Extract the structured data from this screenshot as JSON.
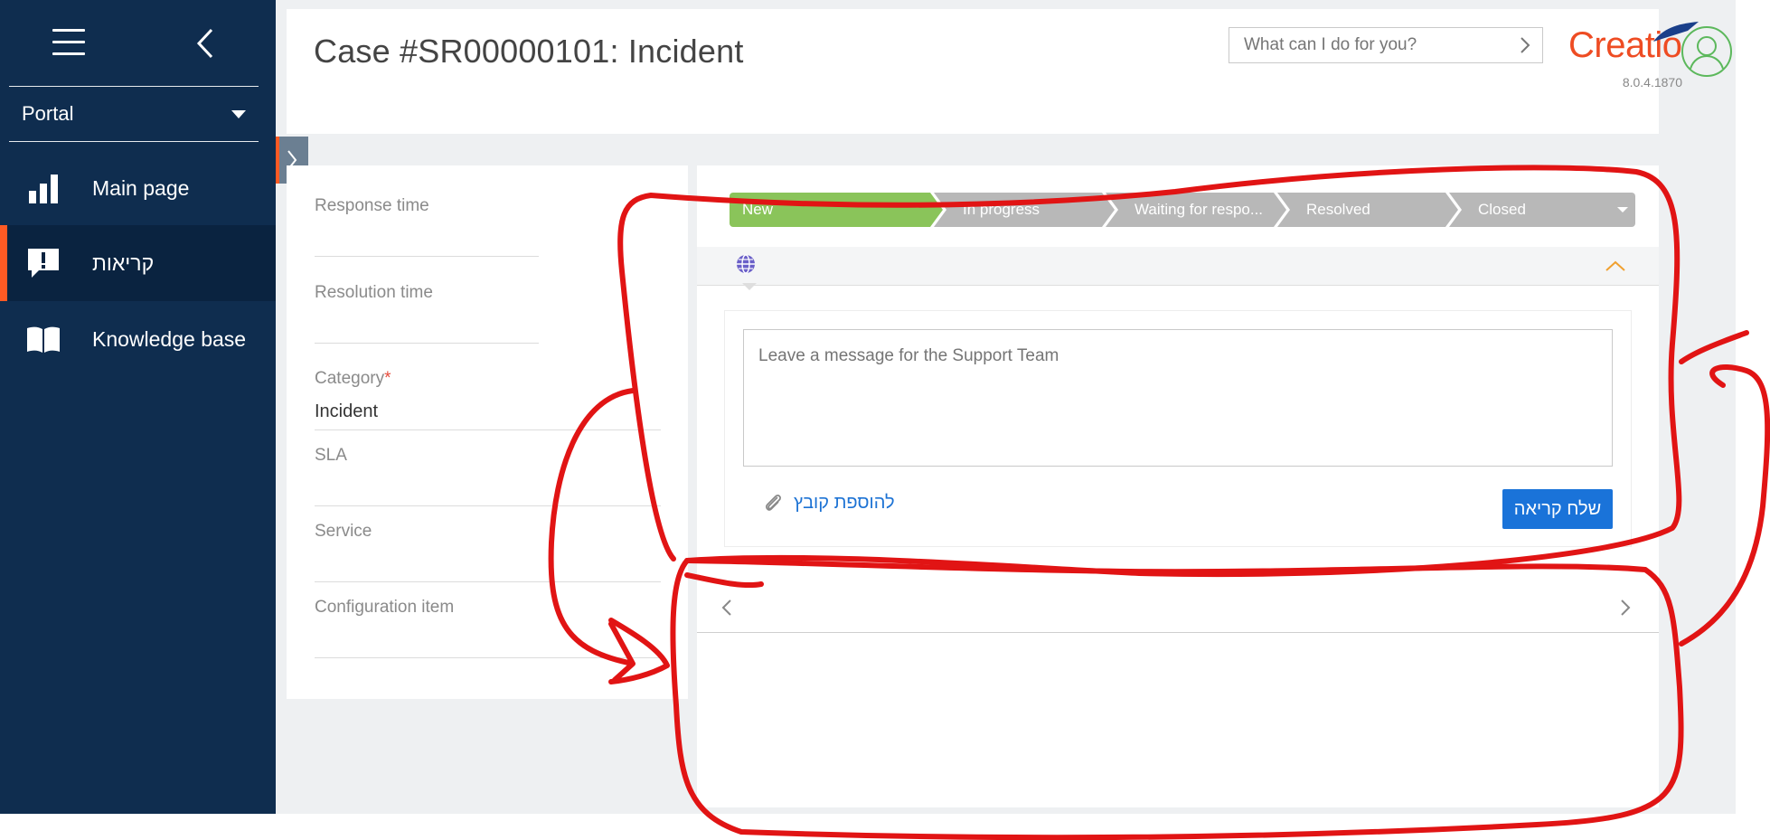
{
  "sidebar": {
    "portal_label": "Portal",
    "items": [
      {
        "label": "Main page",
        "icon": "bar-chart-icon"
      },
      {
        "label": "קריאות",
        "icon": "alert-comment-icon",
        "active": true
      },
      {
        "label": "Knowledge base",
        "icon": "book-icon"
      }
    ]
  },
  "header": {
    "title": "Case #SR00000101: Incident",
    "search_placeholder": "What can I do for you?",
    "logo_text": "Creatio",
    "version": "8.0.4.1870"
  },
  "fields": {
    "response_time_label": "Response time",
    "resolution_time_label": "Resolution time",
    "category_label": "Category",
    "category_required_mark": "*",
    "category_value": "Incident",
    "sla_label": "SLA",
    "service_label": "Service",
    "config_item_label": "Configuration item"
  },
  "stages": [
    {
      "label": "New",
      "active": true
    },
    {
      "label": "In progress"
    },
    {
      "label": "Waiting for respo..."
    },
    {
      "label": "Resolved"
    },
    {
      "label": "Closed"
    }
  ],
  "message": {
    "placeholder": "Leave a message for the Support Team",
    "attach_label": "להוספת קובץ",
    "send_label": "שלח קריאה"
  },
  "colors": {
    "sidebar_bg": "#0f2d4f",
    "accent_orange": "#ff5a24",
    "stage_active": "#8ac45a",
    "stage_inactive": "#b8b8b8",
    "primary_blue": "#1a73d9",
    "annotation_red": "#e11414"
  }
}
